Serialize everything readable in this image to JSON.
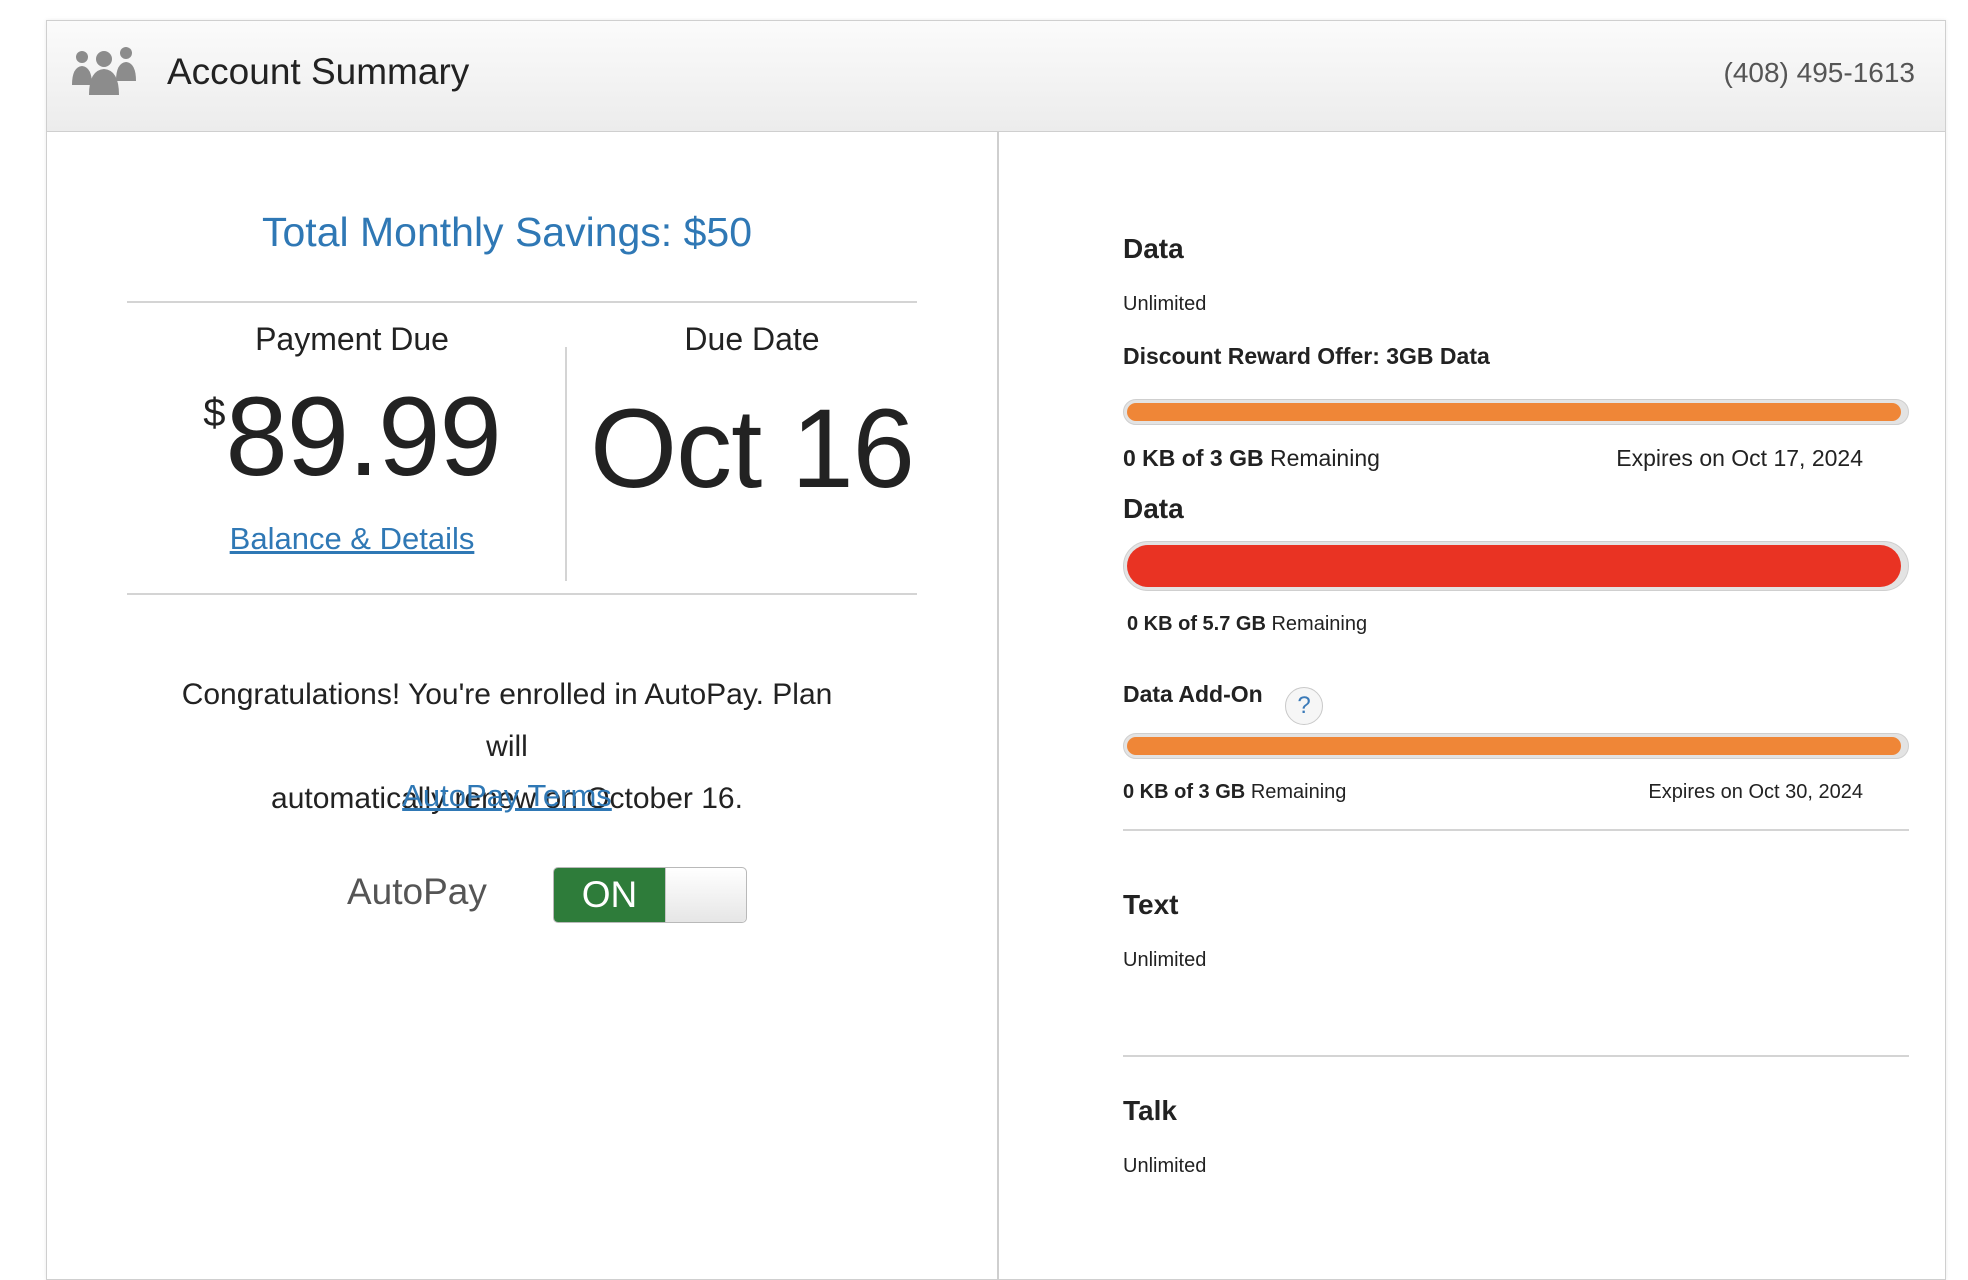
{
  "header": {
    "icon": "people-icon",
    "title": "Account Summary",
    "phone": "(408) 495-1613"
  },
  "summary": {
    "savings": "Total Monthly Savings: $50",
    "payment_label": "Payment Due",
    "currency": "$",
    "amount": "89.99",
    "balance_link": "Balance & Details",
    "due_label": "Due Date",
    "due_date": "Oct 16",
    "congrats_line1": "Congratulations! You're enrolled in AutoPay. Plan will",
    "congrats_line2": "automatically renew on October 16.",
    "autopay_terms": "AutoPay Terms",
    "autopay_label": "AutoPay",
    "autopay_state": "ON"
  },
  "usage": {
    "data": {
      "title": "Data",
      "value": "Unlimited"
    },
    "discount": {
      "title": "Discount Reward Offer: 3GB Data",
      "used": "0 KB of 3 GB",
      "remaining_word": "Remaining",
      "expires": "Expires on Oct 17, 2024",
      "fill_fraction": 0.99,
      "color": "#ef8637"
    },
    "data2": {
      "title": "Data",
      "used": "0 KB of 5.7 GB",
      "remaining_word": "Remaining",
      "fill_fraction": 0.99,
      "color": "#e93323"
    },
    "addon": {
      "title": "Data Add-On",
      "help": "?",
      "help_icon": "help-icon",
      "used": "0 KB of 3 GB",
      "remaining_word": "Remaining",
      "expires": "Expires on Oct 30, 2024",
      "fill_fraction": 0.99,
      "color": "#ef8637"
    },
    "text": {
      "title": "Text",
      "value": "Unlimited"
    },
    "talk": {
      "title": "Talk",
      "value": "Unlimited"
    }
  },
  "colors": {
    "accent": "#2f78b5",
    "toggle_on": "#2e7c3a"
  }
}
